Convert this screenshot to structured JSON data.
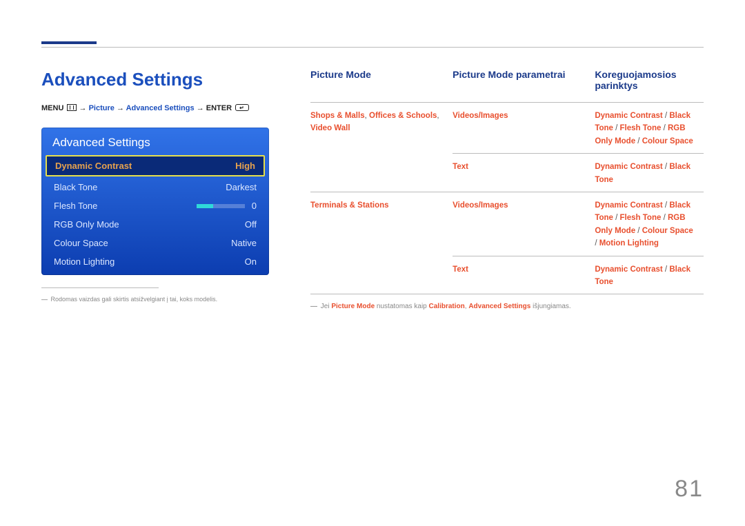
{
  "page_number": "81",
  "title": "Advanced Settings",
  "breadcrumb": {
    "menu": "MENU",
    "picture": "Picture",
    "advanced": "Advanced Settings",
    "enter": "ENTER",
    "arrow": "→"
  },
  "osd": {
    "title": "Advanced Settings",
    "rows": [
      {
        "label": "Dynamic Contrast",
        "value": "High",
        "selected": true
      },
      {
        "label": "Black Tone",
        "value": "Darkest"
      },
      {
        "label": "Flesh Tone",
        "value": "0",
        "slider": true
      },
      {
        "label": "RGB Only Mode",
        "value": "Off"
      },
      {
        "label": "Colour Space",
        "value": "Native"
      },
      {
        "label": "Motion Lighting",
        "value": "On"
      }
    ]
  },
  "footnote_left": "Rodomas vaizdas gali skirtis atsižvelgiant į tai, koks modelis.",
  "table": {
    "headers": [
      "Picture Mode",
      "Picture Mode parametrai",
      "Koreguojamosios parinktys"
    ],
    "rows": [
      {
        "c1_parts": [
          "Shops & Malls",
          ", ",
          "Offices & Schools",
          ", ",
          "Video Wall"
        ],
        "c2": "Videos/Images",
        "c3_parts": [
          "Dynamic Contrast",
          " / ",
          "Black Tone",
          " / ",
          "Flesh Tone",
          " / ",
          "RGB Only Mode",
          " / ",
          "Colour Space"
        ]
      },
      {
        "c1_parts": [],
        "c2": "Text",
        "c3_parts": [
          "Dynamic Contrast",
          " / ",
          "Black Tone"
        ]
      },
      {
        "c1_parts": [
          "Terminals & Stations"
        ],
        "c2": "Videos/Images",
        "c3_parts": [
          "Dynamic Contrast",
          " / ",
          "Black Tone",
          " / ",
          "Flesh Tone",
          " / ",
          "RGB Only Mode",
          " / ",
          "Colour Space",
          " / ",
          "Motion Lighting"
        ]
      },
      {
        "c1_parts": [],
        "c2": "Text",
        "c3_parts": [
          "Dynamic Contrast",
          " / ",
          "Black Tone"
        ]
      }
    ]
  },
  "below_note": {
    "prefix": "Jei ",
    "b1": "Picture Mode",
    "mid1": " nustatomas kaip ",
    "b2": "Calibration",
    "comma": ", ",
    "b3": "Advanced Settings",
    "suffix": " išjungiamas."
  }
}
